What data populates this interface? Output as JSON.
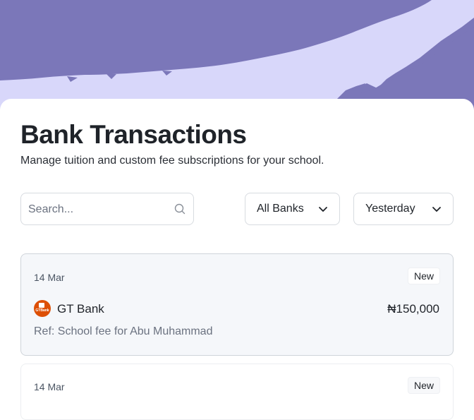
{
  "header": {
    "title": "Bank Transactions",
    "subtitle": "Manage tuition and custom fee subscriptions for your school.",
    "hero_colors": {
      "dark": "#7b77b9",
      "light": "#d8d7fa"
    }
  },
  "filters": {
    "search_placeholder": "Search...",
    "bank_filter": "All Banks",
    "date_filter": "Yesterday"
  },
  "transactions": [
    {
      "date": "14 Mar",
      "badge": "New",
      "bank": "GT Bank",
      "bank_logo_text": "GTBank",
      "bank_color": "#dd4f05",
      "amount": "₦150,000",
      "reference": "Ref: School fee for Abu Muhammad"
    },
    {
      "date": "14 Mar",
      "badge": "New"
    }
  ]
}
